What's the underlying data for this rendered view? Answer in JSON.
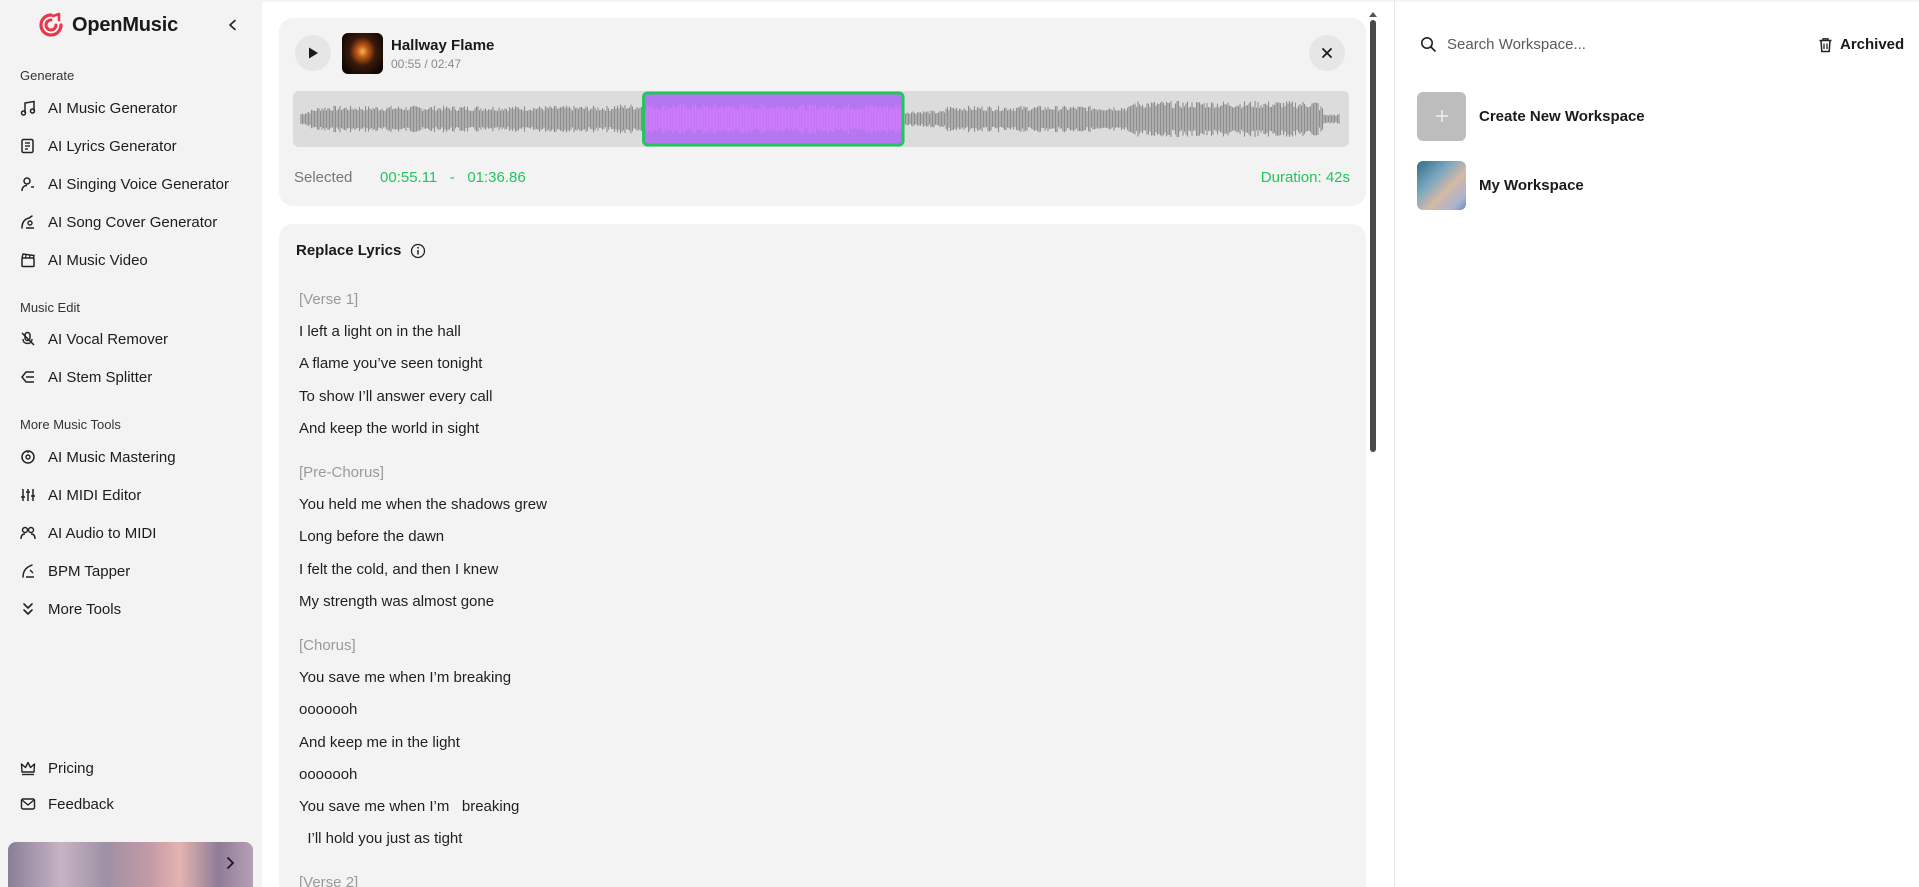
{
  "app": {
    "name": "OpenMusic"
  },
  "sidebar": {
    "sections": [
      {
        "label": "Generate",
        "items": [
          {
            "label": "AI Music Generator",
            "icon": "music-note-icon"
          },
          {
            "label": "AI Lyrics Generator",
            "icon": "lyrics-document-icon"
          },
          {
            "label": "AI Singing Voice Generator",
            "icon": "singer-icon"
          },
          {
            "label": "AI Song Cover Generator",
            "icon": "song-cover-icon"
          },
          {
            "label": "AI Music Video",
            "icon": "clapperboard-icon"
          }
        ]
      },
      {
        "label": "Music Edit",
        "items": [
          {
            "label": "AI Vocal Remover",
            "icon": "vocal-remover-icon"
          },
          {
            "label": "AI Stem Splitter",
            "icon": "stem-splitter-icon"
          }
        ]
      },
      {
        "label": "More Music Tools",
        "items": [
          {
            "label": "AI Music Mastering",
            "icon": "mastering-icon"
          },
          {
            "label": "AI MIDI Editor",
            "icon": "sliders-icon"
          },
          {
            "label": "AI Audio to MIDI",
            "icon": "audio-to-midi-icon"
          },
          {
            "label": "BPM Tapper",
            "icon": "tap-icon"
          },
          {
            "label": "More Tools",
            "icon": "chevrons-down-icon"
          }
        ]
      }
    ],
    "footer": [
      {
        "label": "Pricing",
        "icon": "crown-icon"
      },
      {
        "label": "Feedback",
        "icon": "mail-icon"
      }
    ]
  },
  "player": {
    "title": "Hallway Flame",
    "time": "00:55 / 02:47",
    "selection": {
      "label": "Selected",
      "start": "00:55.11",
      "end": "01:36.86",
      "separator": "-",
      "duration": "Duration: 42s",
      "start_fraction": 0.33,
      "end_fraction": 0.58
    }
  },
  "lyrics": {
    "heading": "Replace Lyrics",
    "lines": [
      {
        "text": "[Verse 1]",
        "tag": true
      },
      {
        "text": "I left a light on in the hall",
        "tag": false
      },
      {
        "text": "A flame you’ve seen tonight",
        "tag": false
      },
      {
        "text": "To show I’ll answer every call",
        "tag": false
      },
      {
        "text": "And keep the world in sight",
        "tag": false
      },
      {
        "text": "[Pre-Chorus]",
        "tag": true
      },
      {
        "text": "You held me when the shadows grew",
        "tag": false
      },
      {
        "text": "Long before the dawn",
        "tag": false
      },
      {
        "text": "I felt the cold, and then I knew",
        "tag": false
      },
      {
        "text": "My strength was almost gone",
        "tag": false
      },
      {
        "text": "[Chorus]",
        "tag": true
      },
      {
        "text": "You save me when I’m breaking",
        "tag": false
      },
      {
        "text": "ooooooh",
        "tag": false
      },
      {
        "text": "And keep me in the light",
        "tag": false
      },
      {
        "text": "ooooooh",
        "tag": false
      },
      {
        "text": "You save me when I’m   breaking",
        "tag": false
      },
      {
        "text": "  I’ll hold you just as tight",
        "tag": false
      },
      {
        "text": "[Verse 2]",
        "tag": true
      }
    ]
  },
  "workspace": {
    "search_placeholder": "Search Workspace...",
    "archived_label": "Archived",
    "items": [
      {
        "name": "Create New Workspace",
        "icon": "plus-icon"
      },
      {
        "name": "My Workspace",
        "icon": "workspace-thumbnail"
      }
    ]
  },
  "colors": {
    "accent_green": "#22c55e",
    "selection_purple": "#a855f7",
    "brand_red": "#e8364a",
    "panel_bg": "#f3f3f3"
  }
}
